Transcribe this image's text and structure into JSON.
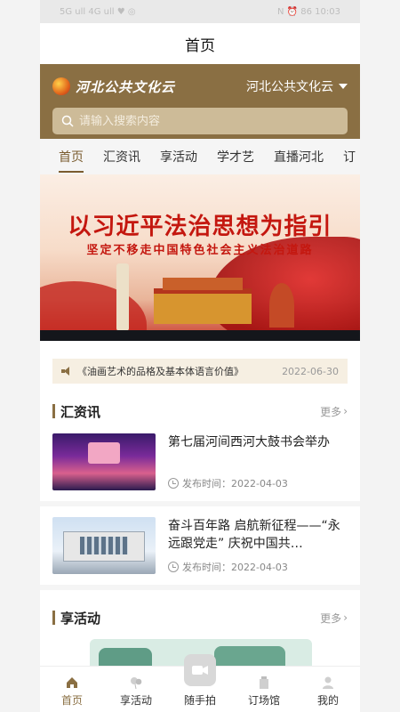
{
  "status_bar": {
    "left": "5G ull 4G ull ♥ ◎",
    "right": "N ⏰ 86 10:03"
  },
  "header": {
    "title": "首页"
  },
  "brand": {
    "logo_text": "河北公共文化云",
    "region": "河北公共文化云"
  },
  "search": {
    "placeholder": "请输入搜索内容"
  },
  "tabs": [
    {
      "label": "首页",
      "active": true
    },
    {
      "label": "汇资讯"
    },
    {
      "label": "享活动"
    },
    {
      "label": "学才艺"
    },
    {
      "label": "直播河北"
    },
    {
      "label": "订"
    }
  ],
  "banner": {
    "headline": "以习近平法治思想为指引",
    "subline": "坚定不移走中国特色社会主义法治道路"
  },
  "notice": {
    "text": "《油画艺术的品格及基本体语言价值》",
    "date": "2022-06-30"
  },
  "news_section": {
    "title": "汇资讯",
    "more": "更多",
    "items": [
      {
        "title": "第七届河间西河大鼓书会举办",
        "time": "发布时间：2022-04-03"
      },
      {
        "title": "奋斗百年路 启航新征程——“永远跟党走” 庆祝中国共…",
        "time": "发布时间：2022-04-03"
      }
    ]
  },
  "activity_section": {
    "title": "享活动",
    "more": "更多"
  },
  "tabbar": [
    {
      "label": "首页",
      "icon": "home-icon",
      "active": true
    },
    {
      "label": "享活动",
      "icon": "balloon-icon"
    },
    {
      "label": "随手拍",
      "icon": "camera-icon"
    },
    {
      "label": "订场馆",
      "icon": "building-icon"
    },
    {
      "label": "我的",
      "icon": "person-icon"
    }
  ],
  "colors": {
    "brand": "#8a6f43",
    "search_bg": "#cdbb98",
    "notice_bg": "#f6efe2",
    "banner_red": "#c4170f"
  }
}
